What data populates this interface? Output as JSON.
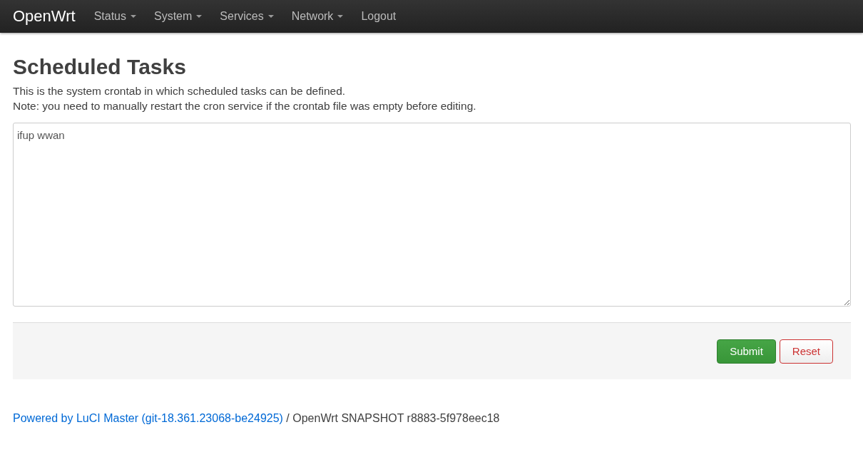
{
  "navbar": {
    "brand": "OpenWrt",
    "items": [
      {
        "label": "Status",
        "dropdown": true
      },
      {
        "label": "System",
        "dropdown": true
      },
      {
        "label": "Services",
        "dropdown": true
      },
      {
        "label": "Network",
        "dropdown": true
      },
      {
        "label": "Logout",
        "dropdown": false
      }
    ]
  },
  "page": {
    "title": "Scheduled Tasks",
    "description": [
      "This is the system crontab in which scheduled tasks can be defined.",
      "Note: you need to manually restart the cron service if the crontab file was empty before editing."
    ]
  },
  "editor": {
    "value": "ifup wwan"
  },
  "actions": {
    "buttons": [
      {
        "label": "Submit",
        "kind": "primary"
      },
      {
        "label": "Reset",
        "kind": "reset"
      }
    ]
  },
  "footer": {
    "link": "Powered by LuCI Master (git-18.361.23068-be24925)",
    "text": " / OpenWrt SNAPSHOT r8883-5f978eec18"
  }
}
